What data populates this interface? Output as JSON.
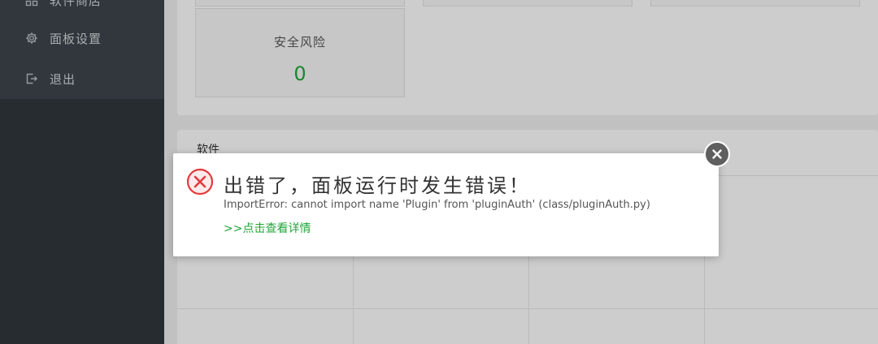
{
  "sidebar": {
    "items": [
      {
        "label": "软件商店",
        "icon": "grid-icon"
      },
      {
        "label": "面板设置",
        "icon": "gear-icon"
      },
      {
        "label": "退出",
        "icon": "logout-icon"
      }
    ]
  },
  "stats": {
    "security_risk": {
      "title": "安全风险",
      "value": "0"
    }
  },
  "software_panel": {
    "title": "软件"
  },
  "error_dialog": {
    "title": "出错了，面板运行时发生错误！",
    "message": "ImportError: cannot import name 'Plugin' from 'pluginAuth' (class/pluginAuth.py)",
    "details_link": ">>点击查看详情",
    "icon": "error-circle-icon",
    "close_icon": "close-icon"
  },
  "colors": {
    "accent": "#20a53a",
    "error": "#e4393c",
    "sidebar_bg": "#3d444c"
  }
}
